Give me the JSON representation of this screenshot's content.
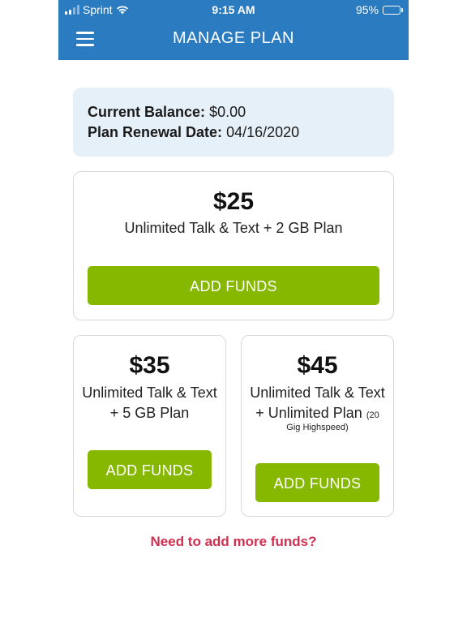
{
  "status_bar": {
    "carrier": "Sprint",
    "time": "9:15 AM",
    "battery": "95%",
    "battery_level": 0.95
  },
  "header": {
    "title": "MANAGE PLAN",
    "menu_icon": "hamburger-menu-icon"
  },
  "balance": {
    "balance_label": "Current Balance:",
    "balance_value": "$0.00",
    "renewal_label": "Plan Renewal Date:",
    "renewal_value": "04/16/2020"
  },
  "plans": [
    {
      "price": "$25",
      "desc_line1": "Unlimited Talk & Text + 2 GB Plan",
      "button": "ADD FUNDS"
    },
    {
      "price": "$35",
      "desc_line1": "Unlimited Talk & Text",
      "desc_line2": "+ 5 GB Plan",
      "button": "ADD FUNDS"
    },
    {
      "price": "$45",
      "desc_line1": "Unlimited Talk & Text",
      "desc_line2": "+ Unlimited Plan",
      "desc_small": "(20",
      "note": "Gig Highspeed)",
      "button": "ADD FUNDS"
    }
  ],
  "footer": {
    "more_funds_link": "Need to add more funds?"
  },
  "colors": {
    "header_blue": "#2a7bc0",
    "button_green": "#86b800",
    "link_red": "#d0304f",
    "balance_bg": "#e6f0f8"
  }
}
